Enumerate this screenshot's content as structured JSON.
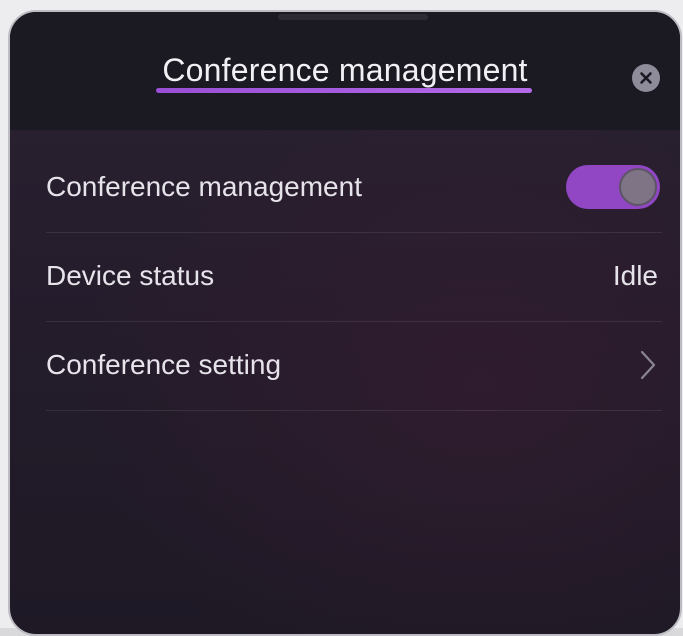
{
  "header": {
    "title": "Conference management",
    "close_icon": "close-circle-icon"
  },
  "rows": [
    {
      "label": "Conference management",
      "control": "toggle",
      "toggle_on": true
    },
    {
      "label": "Device status",
      "value": "Idle"
    },
    {
      "label": "Conference setting",
      "icon": "chevron-right-icon"
    }
  ],
  "colors": {
    "accent": "#9147c4",
    "panel_bg": "#241c2b",
    "header_bg": "#1b1922"
  }
}
